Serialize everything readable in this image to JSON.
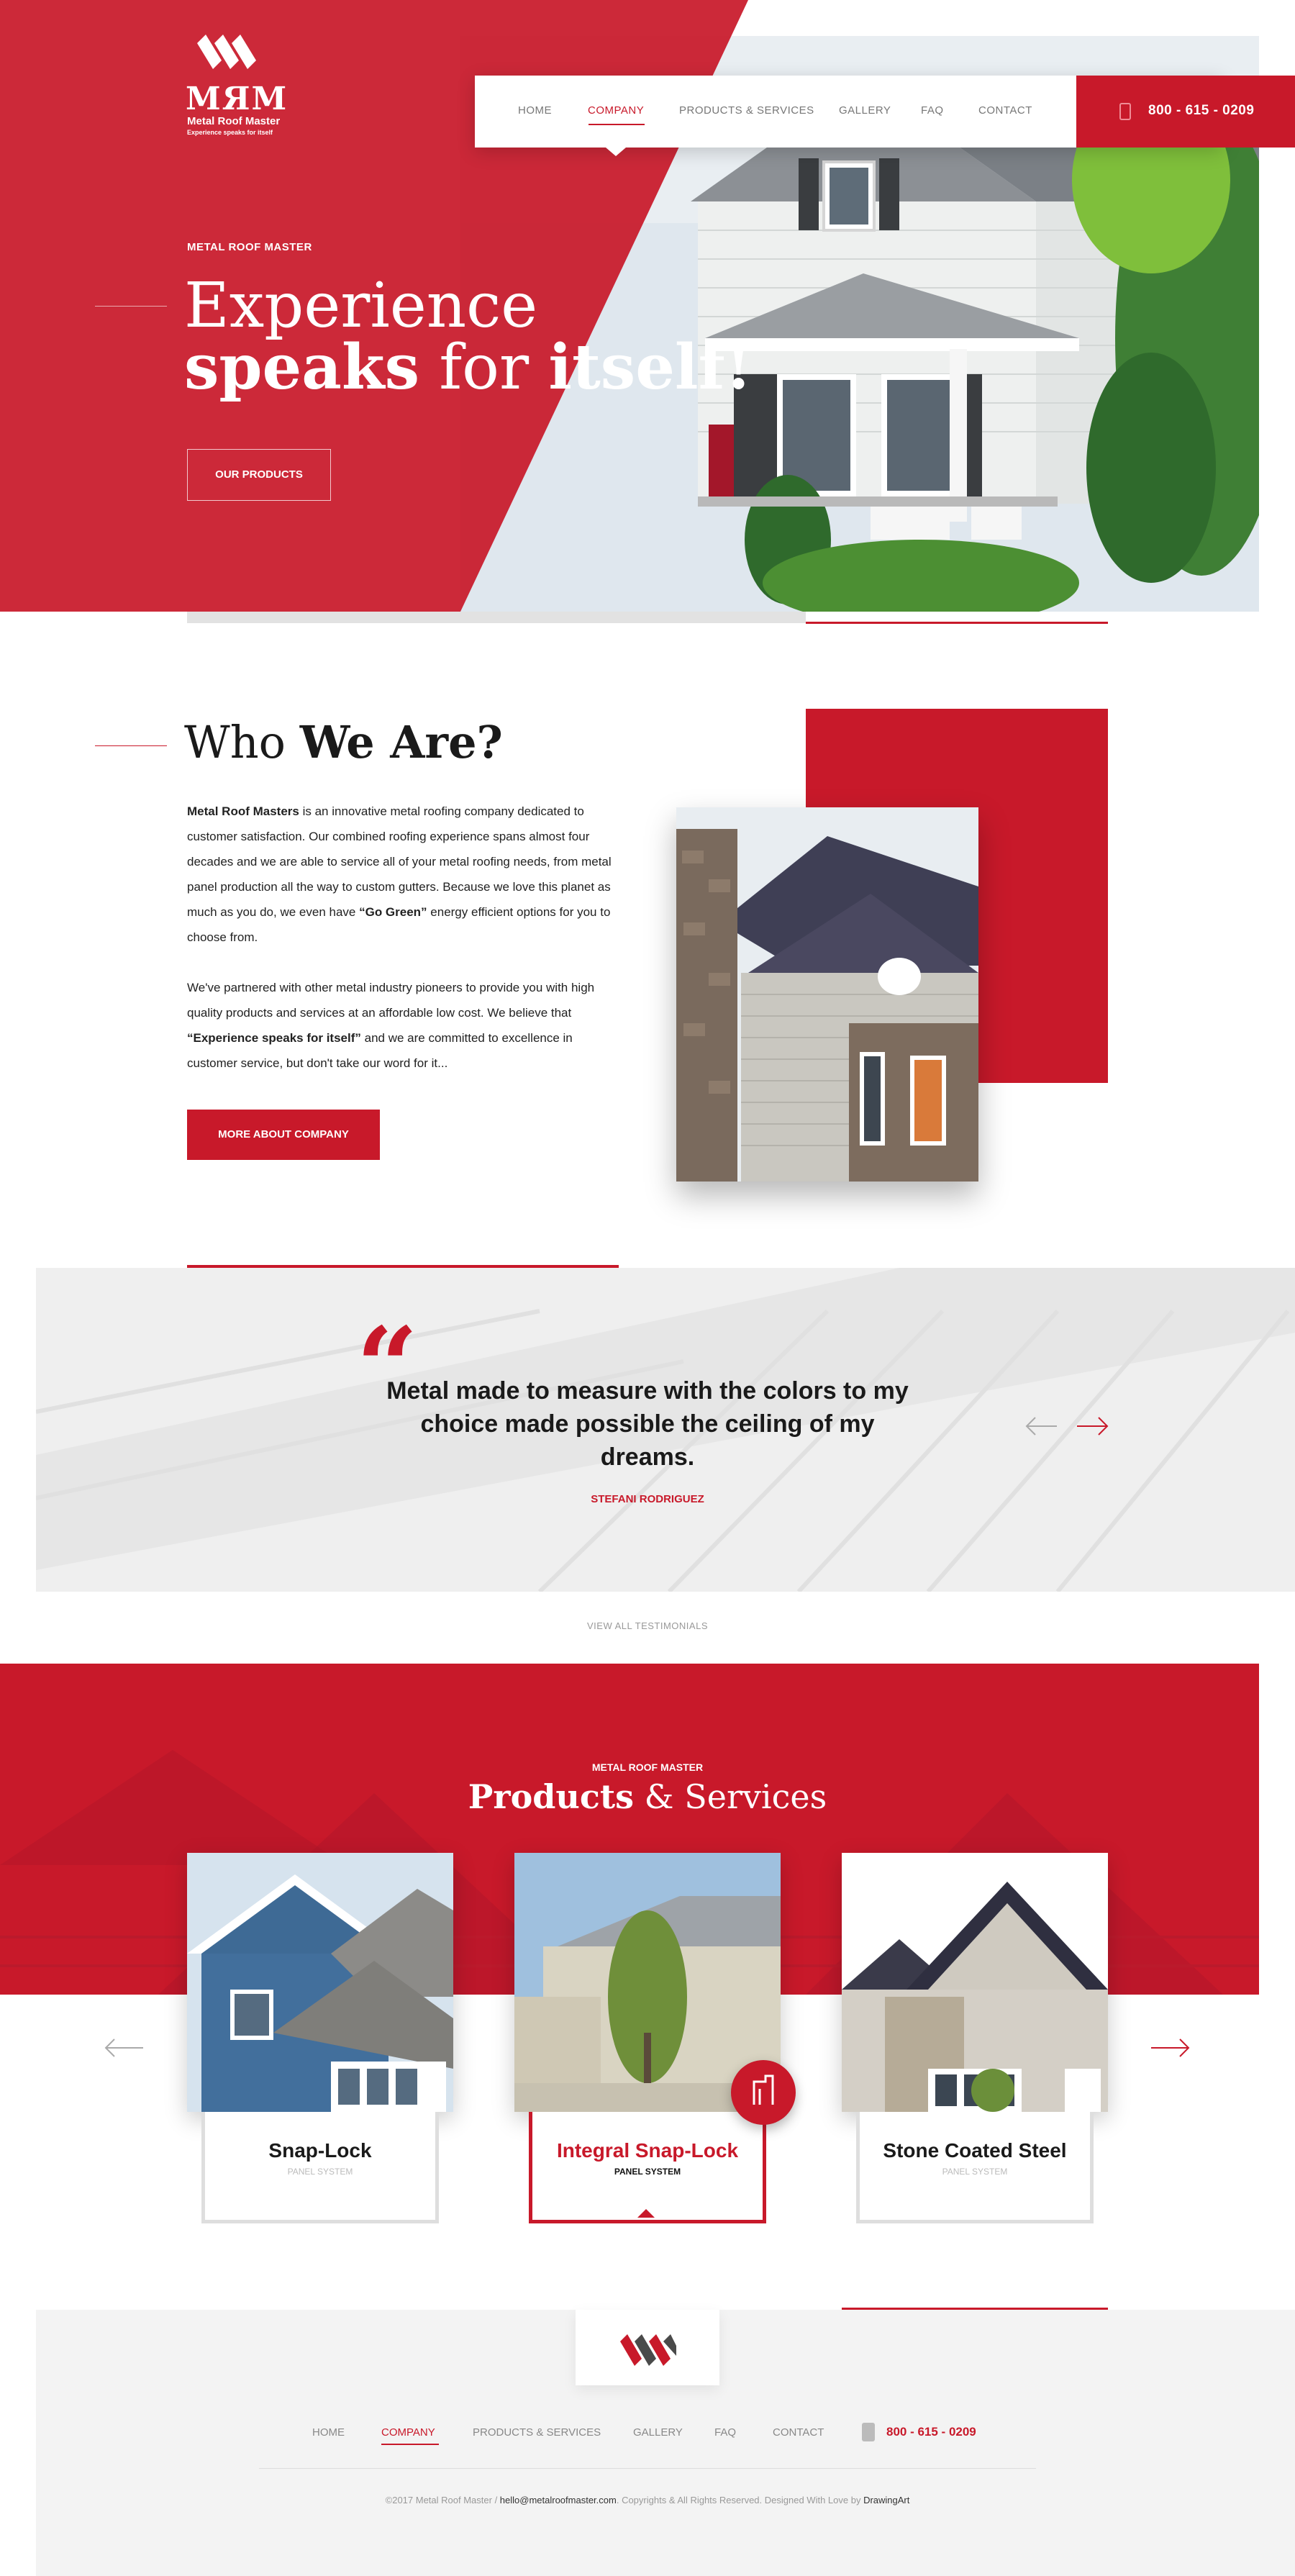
{
  "brand": {
    "logo_letters": "MЯM",
    "name": "Metal Roof Master",
    "tagline": "Experience speaks for itself"
  },
  "nav": {
    "items": [
      {
        "label": "HOME",
        "active": false
      },
      {
        "label": "COMPANY",
        "active": true
      },
      {
        "label": "PRODUCTS & SERVICES",
        "active": false
      },
      {
        "label": "GALLERY",
        "active": false
      },
      {
        "label": "FAQ",
        "active": false
      },
      {
        "label": "CONTACT",
        "active": false
      }
    ],
    "phone": "800 - 615 - 0209",
    "phone_icon": "phone-icon"
  },
  "hero": {
    "eyebrow": "METAL ROOF MASTER",
    "title_line1": "Experience",
    "title_word_a": "speaks",
    "title_word_b": "for",
    "title_word_c": "itself!",
    "button": "OUR PRODUCTS"
  },
  "who": {
    "title_light": "Who",
    "title_bold": "We Are?",
    "p1_bold": "Metal Roof Masters",
    "p1_a": " is an innovative metal roofing company dedicated to customer satisfaction. Our combined roofing experience spans almost four decades and we are able to service all of your metal roofing needs, from metal panel production all the way to custom gutters. Because we love this planet as much as you do, we even have ",
    "p1_bold2": "“Go Green”",
    "p1_b": " energy efficient options for you to choose from.",
    "p2_a": "We've partnered with other metal industry pioneers to provide you with high quality products and services at an affordable low cost. We believe that ",
    "p2_bold": "“Experience speaks for itself”",
    "p2_b": " and we are committed to excellence in customer service, but don't take our word for it...",
    "button": "MORE ABOUT COMPANY"
  },
  "testimonial": {
    "quote_mark": "“",
    "text": "Metal made to measure with the colors to my choice made possible the ceiling of my dreams.",
    "author": "STEFANI RODRIGUEZ",
    "view_all": "VIEW ALL TESTIMONIALS"
  },
  "products": {
    "eyebrow": "METAL ROOF MASTER",
    "title_bold": "Products",
    "title_rest": "& Services",
    "cards": [
      {
        "name": "Snap-Lock",
        "sub": "PANEL SYSTEM",
        "active": false
      },
      {
        "name": "Integral Snap-Lock",
        "sub": "PANEL SYSTEM",
        "active": true
      },
      {
        "name": "Stone Coated Steel",
        "sub": "PANEL SYSTEM",
        "active": false
      }
    ]
  },
  "footer": {
    "nav": [
      "HOME",
      "COMPANY",
      "PRODUCTS & SERVICES",
      "GALLERY",
      "FAQ",
      "CONTACT"
    ],
    "phone": "800 - 615 - 0209",
    "copy_a": "©2017 Metal Roof Master / ",
    "email": "hello@metalroofmaster.com",
    "copy_b": ". Copyrights & All Rights Reserved. Designed With Love by ",
    "designer": "DrawingArt"
  },
  "colors": {
    "accent": "#c8192a",
    "light_gray": "#efefef"
  }
}
